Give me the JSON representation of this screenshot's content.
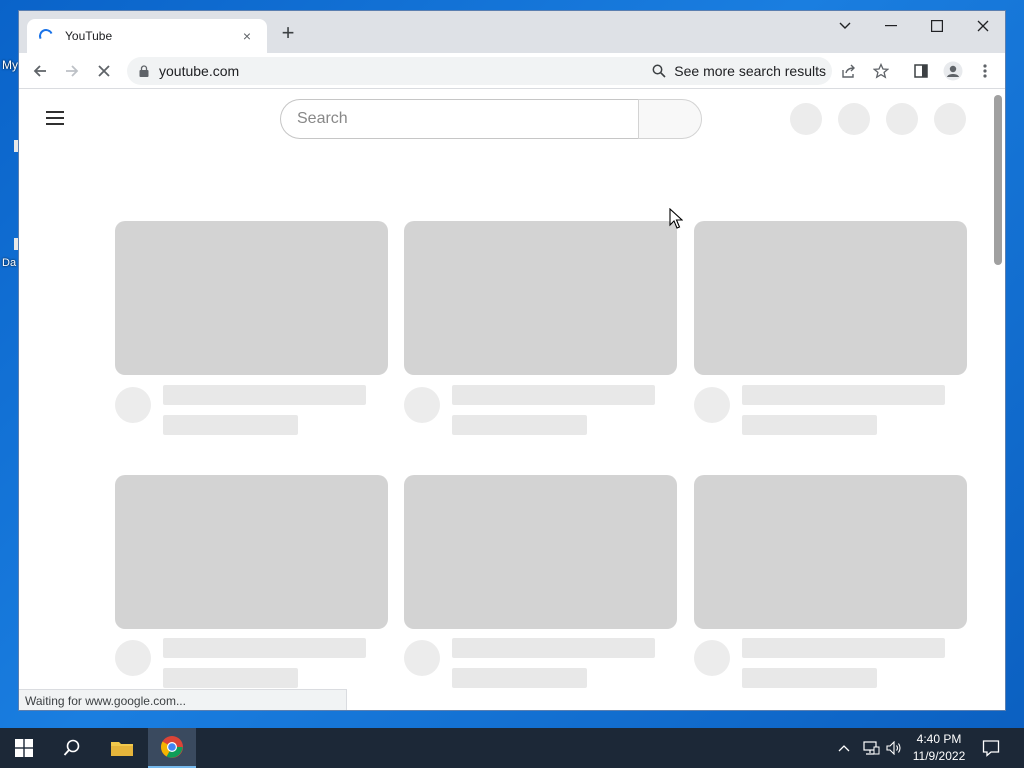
{
  "desktop": {
    "icon_labels": [
      "My",
      "Da"
    ]
  },
  "browser": {
    "tab": {
      "title": "YouTube",
      "close": "×"
    },
    "new_tab": "+",
    "window_controls": {
      "tab_search": "⌄",
      "minimize": "—",
      "maximize": "☐",
      "close": "✕"
    },
    "address": {
      "url": "youtube.com",
      "search_more": "See more search results"
    },
    "status_text": "Waiting for www.google.com..."
  },
  "youtube": {
    "search_placeholder": "Search"
  },
  "taskbar": {
    "time": "4:40 PM",
    "date": "11/9/2022"
  },
  "colors": {
    "desktop_blue": "#0a63c9",
    "skeleton_thumb": "#d3d3d3",
    "skeleton_line": "#e8e8e8",
    "taskbar": "#1c2837"
  }
}
